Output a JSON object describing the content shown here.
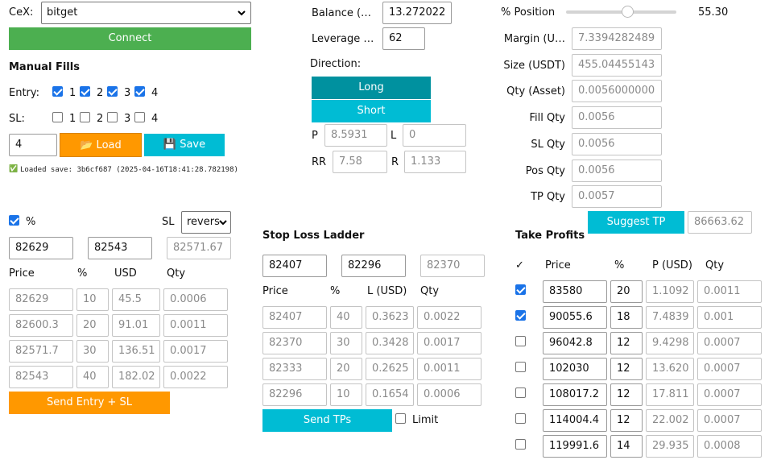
{
  "cex": {
    "label": "CeX:",
    "value": "bitget",
    "connect": "Connect"
  },
  "manual": {
    "title": "Manual Fills",
    "entry_label": "Entry:",
    "sl_label": "SL:",
    "nums": [
      "1",
      "2",
      "3",
      "4"
    ],
    "entry_checked": [
      true,
      true,
      true,
      true
    ],
    "sl_checked": [
      false,
      false,
      false,
      false
    ],
    "slot_value": "4",
    "load": "📂 Load",
    "save": "💾 Save",
    "status_icon": "✅",
    "status": "Loaded save: 3b6cf687 (2025-04-16T18:41:28.782198)"
  },
  "balance": {
    "label": "Balance (…",
    "value": "13.272022"
  },
  "leverage": {
    "label": "Leverage …",
    "value": "62"
  },
  "direction": {
    "label": "Direction:",
    "long": "Long",
    "short": "Short"
  },
  "pl": {
    "p_label": "P",
    "p_value": "8.5931",
    "l_label": "L",
    "l_value": "0"
  },
  "rr": {
    "rr_label": "RR",
    "rr_value": "7.58",
    "r_label": "R",
    "r_value": "1.133"
  },
  "position": {
    "pct_label": "% Position",
    "pct_value": "55.30",
    "slider_fraction": 0.553,
    "fields": [
      {
        "label": "Margin (U…",
        "value": "7.3394282489"
      },
      {
        "label": "Size (USDT)",
        "value": "455.04455143"
      },
      {
        "label": "Qty (Asset)",
        "value": "0.0056000000"
      },
      {
        "label": "Fill Qty",
        "value": "0.0056"
      },
      {
        "label": "SL Qty",
        "value": "0.0056"
      },
      {
        "label": "Pos Qty",
        "value": "0.0056"
      },
      {
        "label": "TP Qty",
        "value": "0.0057"
      }
    ],
    "suggest_tp": "Suggest TP",
    "suggest_value": "86663.62"
  },
  "entry": {
    "pct_checked": true,
    "pct_label": "%",
    "sl_label": "SL",
    "sl_mode": "revers",
    "from": "82629",
    "to": "82543",
    "avg": "82571.67",
    "headers": [
      "Price",
      "%",
      "USD",
      "Qty"
    ],
    "rows": [
      {
        "price": "82629",
        "pct": "10",
        "usd": "45.5",
        "qty": "0.0006"
      },
      {
        "price": "82600.3",
        "pct": "20",
        "usd": "91.01",
        "qty": "0.0011"
      },
      {
        "price": "82571.7",
        "pct": "30",
        "usd": "136.51",
        "qty": "0.0017"
      },
      {
        "price": "82543",
        "pct": "40",
        "usd": "182.02",
        "qty": "0.0022"
      }
    ],
    "send": "Send Entry + SL"
  },
  "stoploss": {
    "title": "Stop Loss Ladder",
    "from": "82407",
    "to": "82296",
    "avg": "82370",
    "headers": [
      "Price",
      "%",
      "L (USD)",
      "Qty"
    ],
    "rows": [
      {
        "price": "82407",
        "pct": "40",
        "loss": "0.3623",
        "qty": "0.0022"
      },
      {
        "price": "82370",
        "pct": "30",
        "loss": "0.3428",
        "qty": "0.0017"
      },
      {
        "price": "82333",
        "pct": "20",
        "loss": "0.2625",
        "qty": "0.0011"
      },
      {
        "price": "82296",
        "pct": "10",
        "loss": "0.1654",
        "qty": "0.0006"
      }
    ],
    "send": "Send TPs",
    "limit_label": "Limit",
    "limit_checked": false
  },
  "takeprofit": {
    "title": "Take Profits",
    "headers": [
      "✓",
      "Price",
      "%",
      "P (USD)",
      "Qty"
    ],
    "rows": [
      {
        "checked": true,
        "price": "83580",
        "pct": "20",
        "profit": "1.1092",
        "qty": "0.0011"
      },
      {
        "checked": true,
        "price": "90055.6",
        "pct": "18",
        "profit": "7.4839",
        "qty": "0.001"
      },
      {
        "checked": false,
        "price": "96042.8",
        "pct": "12",
        "profit": "9.4298",
        "qty": "0.0007"
      },
      {
        "checked": false,
        "price": "102030",
        "pct": "12",
        "profit": "13.620",
        "qty": "0.0007"
      },
      {
        "checked": false,
        "price": "108017.2",
        "pct": "12",
        "profit": "17.811",
        "qty": "0.0007"
      },
      {
        "checked": false,
        "price": "114004.4",
        "pct": "12",
        "profit": "22.002",
        "qty": "0.0007"
      },
      {
        "checked": false,
        "price": "119991.6",
        "pct": "14",
        "profit": "29.935",
        "qty": "0.0008"
      }
    ]
  }
}
